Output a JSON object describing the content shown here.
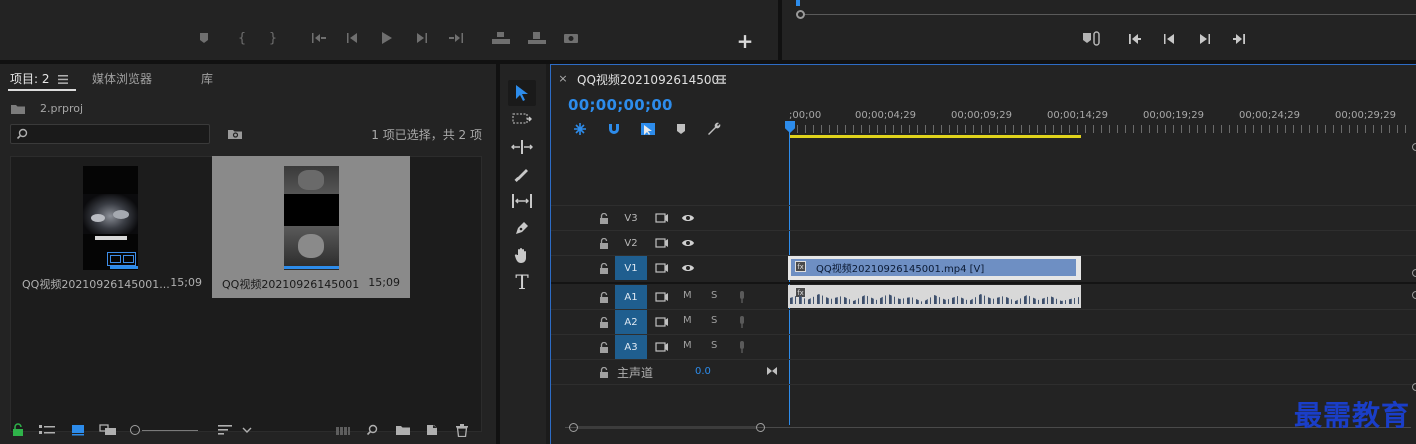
{
  "project_panel": {
    "tabs": [
      {
        "label": "项目: 2"
      },
      {
        "label": "媒体浏览器"
      },
      {
        "label": "库"
      }
    ],
    "project_file": "2.prproj",
    "search_placeholder": "",
    "selection_status": "1 项已选择，共 2 项",
    "items": [
      {
        "name": "QQ视频20210926145001...",
        "duration": "15;09",
        "selected": false
      },
      {
        "name": "QQ视频20210926145001",
        "duration": "15;09",
        "selected": true
      }
    ]
  },
  "timeline": {
    "tab_title": "QQ视频20210926145001",
    "timecode": "00;00;00;00",
    "ruler_labels": [
      ";00;00",
      "00;00;04;29",
      "00;00;09;29",
      "00;00;14;29",
      "00;00;19;29",
      "00;00;24;29",
      "00;00;29;29"
    ],
    "video_tracks": [
      {
        "name": "V3",
        "active": false
      },
      {
        "name": "V2",
        "active": false
      },
      {
        "name": "V1",
        "active": true
      }
    ],
    "audio_tracks": [
      {
        "name": "A1",
        "active": true
      },
      {
        "name": "A2",
        "active": true
      },
      {
        "name": "A3",
        "active": true
      }
    ],
    "mute_label": "M",
    "solo_label": "S",
    "master": {
      "label": "主声道",
      "value": "0.0"
    },
    "video_clip": {
      "label": "QQ视频20210926145001.mp4 [V]"
    }
  },
  "watermark": "最需教育",
  "colors": {
    "accent_blue": "#2d8ceb",
    "track_active": "#1f5e8f",
    "clip_video": "#6e8fc3",
    "clip_audio": "#d8d8d8",
    "work_area": "#e0d31c",
    "panel_bg": "#232323"
  }
}
